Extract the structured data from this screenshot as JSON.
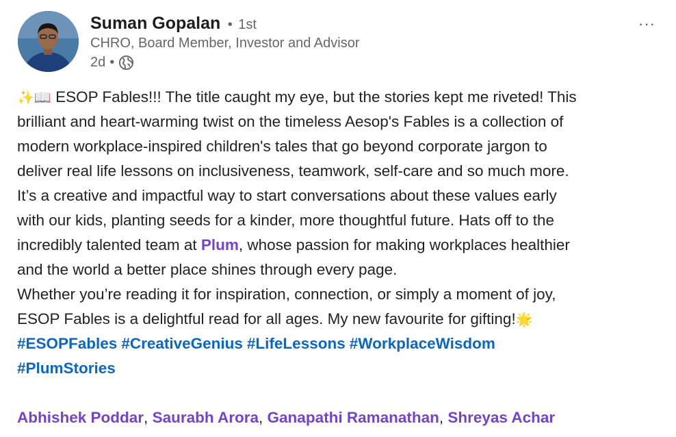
{
  "author": {
    "name": "Suman Gopalan",
    "separator": "•",
    "degree": "1st",
    "headline": "CHRO, Board Member, Investor and Advisor",
    "time": "2d",
    "meta_dot": "•",
    "visibility_icon": "globe-icon"
  },
  "menu": {
    "icon": "more-horizontal-icon",
    "label": "···"
  },
  "post": {
    "emoji_sparkles": "✨",
    "emoji_book": "📖",
    "emoji_star": "🌟",
    "line1": " ESOP Fables!!! The title caught my eye, but the stories kept me riveted! This",
    "line2": "brilliant and heart-warming twist on the timeless Aesop's Fables is a collection of",
    "line3": "modern workplace-inspired children's tales that go beyond corporate jargon to",
    "line4": "deliver real life lessons on inclusiveness, teamwork, self-care and so much more.",
    "line5": "It’s a creative and impactful way to start conversations about these values early",
    "line6": "with our kids, planting seeds for a kinder, more thoughtful future. Hats off to the",
    "line7_before": "incredibly talented team at ",
    "line7_mention": "Plum",
    "line7_after": ", whose passion for making workplaces healthier",
    "line8": "and the world a better place shines through every page.",
    "line9": "Whether you’re reading it for inspiration, connection, or simply a moment of joy,",
    "line10": "ESOP Fables is a delightful read for all ages. My new favourite for gifting!",
    "hashtags": [
      "#ESOPFables",
      "#CreativeGenius",
      "#LifeLessons",
      "#WorkplaceWisdom",
      "#PlumStories"
    ],
    "mentions": [
      "Abhishek Poddar",
      "Saurabh Arora",
      "Ganapathi Ramanathan",
      "Shreyas Achar"
    ],
    "comma": ", "
  }
}
